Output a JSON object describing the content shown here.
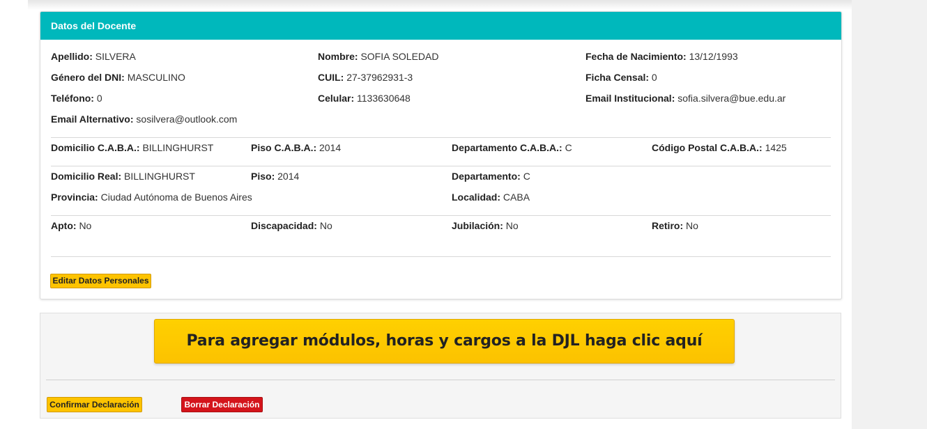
{
  "panel": {
    "title": "Datos del Docente",
    "personal": [
      [
        {
          "label": "Apellido:",
          "value": "SILVERA"
        },
        {
          "label": "Nombre:",
          "value": "SOFIA SOLEDAD"
        },
        {
          "label": "Fecha de Nacimiento:",
          "value": " 13/12/1993"
        }
      ],
      [
        {
          "label": "Género del DNI:",
          "value": "MASCULINO"
        },
        {
          "label": "CUIL:",
          "value": "27-37962931-3"
        },
        {
          "label": "Ficha Censal:",
          "value": "0"
        }
      ],
      [
        {
          "label": "Teléfono:",
          "value": "0"
        },
        {
          "label": "Celular:",
          "value": "1133630648"
        },
        {
          "label": "Email Institucional:",
          "value": "sofia.silvera@bue.edu.ar"
        }
      ],
      [
        {
          "label": "Email Alternativo:",
          "value": "sosilvera@outlook.com"
        }
      ]
    ],
    "caba": [
      {
        "label": "Domicilio C.A.B.A.:",
        "value": "BILLINGHURST"
      },
      {
        "label": "Piso C.A.B.A.:",
        "value": "2014"
      },
      {
        "label": "Departamento C.A.B.A.:",
        "value": "C"
      },
      {
        "label": "Código Postal C.A.B.A.:",
        "value": "1425"
      }
    ],
    "real": [
      [
        {
          "label": "Domicilio Real:",
          "value": "BILLINGHURST"
        },
        {
          "label": "Piso:",
          "value": "2014"
        },
        {
          "label": "Departamento:",
          "value": "C"
        }
      ],
      [
        {
          "label": "Provincia:",
          "value": "Ciudad Autónoma de Buenos Aires"
        },
        {
          "label": "Localidad:",
          "value": "CABA"
        }
      ]
    ],
    "status": [
      {
        "label": "Apto:",
        "value": "No"
      },
      {
        "label": "Discapacidad:",
        "value": "No"
      },
      {
        "label": "Jubilación:",
        "value": "No"
      },
      {
        "label": "Retiro:",
        "value": "No"
      }
    ],
    "edit_button": "Editar Datos Personales"
  },
  "actions": {
    "cta_label": "Para agregar módulos, horas y cargos a la DJL haga clic aquí",
    "confirm_label": "Confirmar Declaración",
    "delete_label": "Borrar Declaración"
  },
  "colors": {
    "header_teal": "#00b8bc",
    "button_yellow": "#fdc300",
    "button_red": "#d4141b"
  }
}
